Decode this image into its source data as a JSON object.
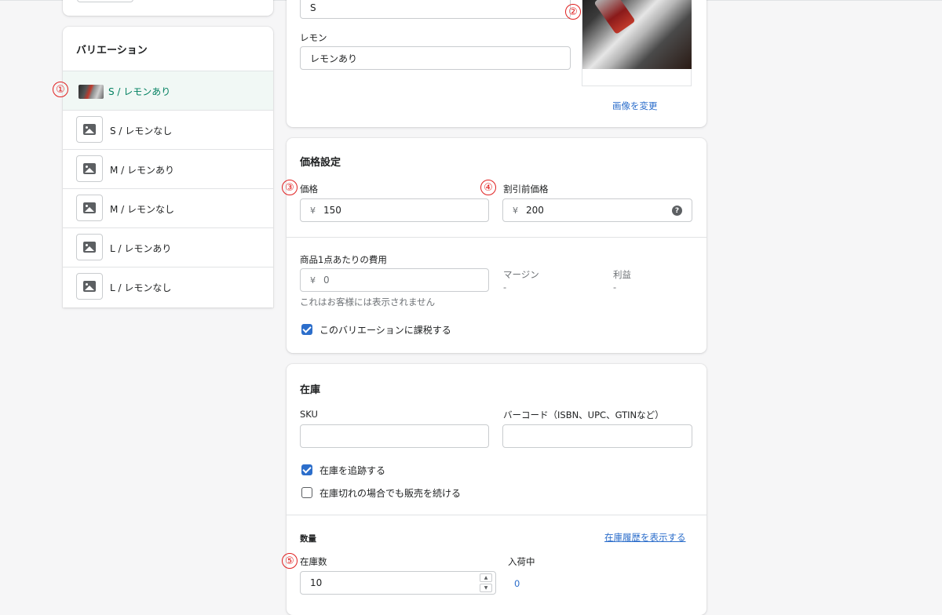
{
  "variations_panel": {
    "title": "バリエーション",
    "items": [
      {
        "label": "S / レモンあり",
        "selected": true,
        "thumb": "cola-photo"
      },
      {
        "label": "S / レモンなし",
        "selected": false,
        "thumb": "image-placeholder-icon"
      },
      {
        "label": "M / レモンあり",
        "selected": false,
        "thumb": "image-placeholder-icon"
      },
      {
        "label": "M / レモンなし",
        "selected": false,
        "thumb": "image-placeholder-icon"
      },
      {
        "label": "L / レモンあり",
        "selected": false,
        "thumb": "image-placeholder-icon"
      },
      {
        "label": "L / レモンなし",
        "selected": false,
        "thumb": "image-placeholder-icon"
      }
    ]
  },
  "options_card": {
    "size_value": "S",
    "lemon_label": "レモン",
    "lemon_value": "レモンあり",
    "change_image_link": "画像を変更"
  },
  "pricing": {
    "title": "価格設定",
    "price_label": "価格",
    "currency": "¥",
    "price_value": "150",
    "compare_label": "割引前価格",
    "compare_value": "200",
    "cost_label": "商品1点あたりの費用",
    "cost_value": "0",
    "cost_help": "これはお客様には表示されません",
    "margin_label": "マージン",
    "margin_value": "-",
    "profit_label": "利益",
    "profit_value": "-",
    "tax_checkbox_label": "このバリエーションに課税する",
    "tax_checked": true
  },
  "inventory": {
    "title": "在庫",
    "sku_label": "SKU",
    "sku_value": "",
    "barcode_label": "バーコード（ISBN、UPC、GTINなど）",
    "barcode_value": "",
    "track_label": "在庫を追跡する",
    "track_checked": true,
    "continue_label": "在庫切れの場合でも販売を続ける",
    "continue_checked": false,
    "quantity_heading": "数量",
    "history_link": "在庫履歴を表示する",
    "available_label": "在庫数",
    "available_value": "10",
    "incoming_label": "入荷中",
    "incoming_value": "0"
  },
  "annotations": [
    "①",
    "②",
    "③",
    "④",
    "⑤"
  ],
  "colors": {
    "accent_blue": "#2c6ecb",
    "selected_green": "#007f5f",
    "marker_red": "#e02020"
  }
}
